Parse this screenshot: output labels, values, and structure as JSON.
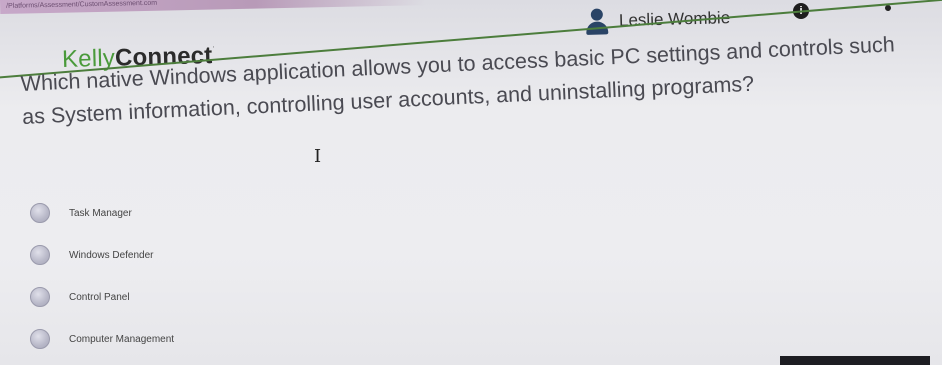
{
  "browser": {
    "url": "/Platforms/Assessment/CustomAssessment.com"
  },
  "header": {
    "logo_kelly": "Kelly",
    "logo_connect": "Connect",
    "logo_tm": "·",
    "user_name": "Leslie Wombie",
    "info_glyph": "i"
  },
  "question": {
    "text": "Which native Windows application allows you to access basic PC settings and controls such as System information, controlling user accounts, and uninstalling programs?"
  },
  "options": [
    {
      "label": "Task Manager"
    },
    {
      "label": "Windows Defender"
    },
    {
      "label": "Control Panel"
    },
    {
      "label": "Computer Management"
    }
  ],
  "colors": {
    "brand_green": "#4a9a3b",
    "header_rule": "#4c7d3c",
    "user_icon": "#2a4466",
    "question_text": "#4a4a52"
  }
}
